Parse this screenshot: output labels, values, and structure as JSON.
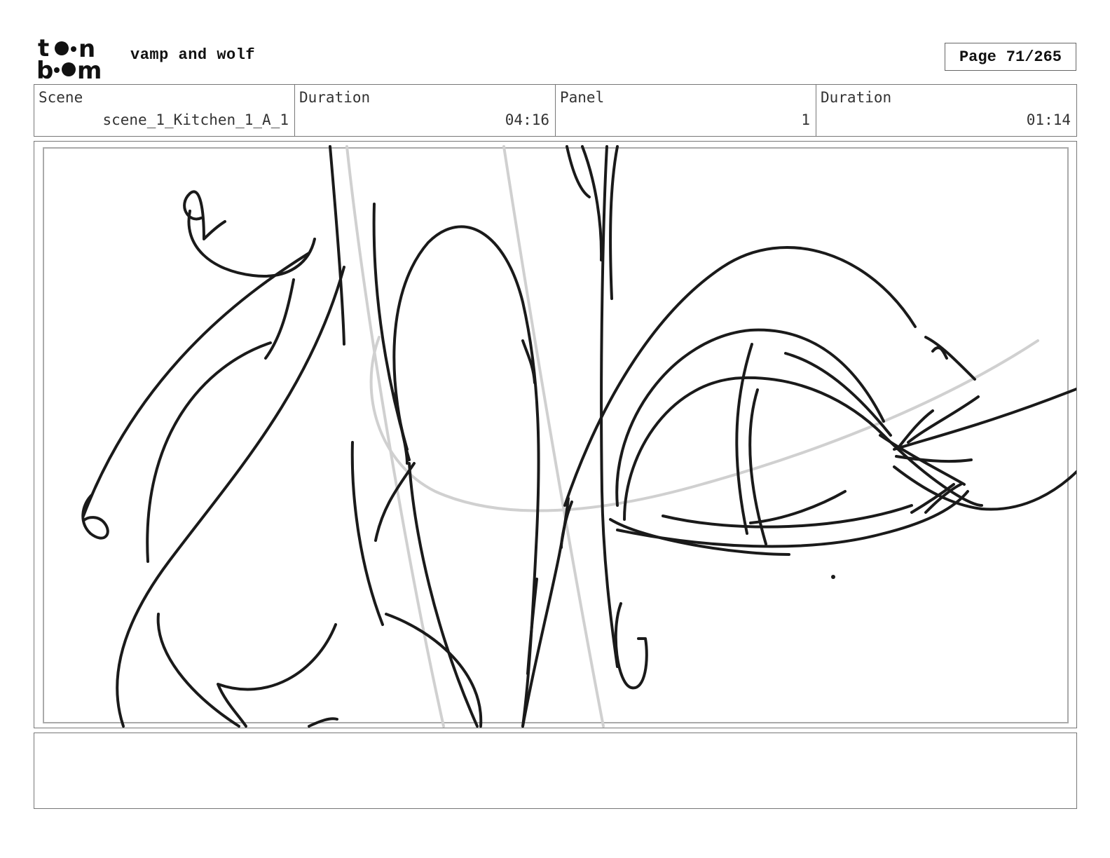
{
  "header": {
    "logo_lines": [
      "toon",
      "boom"
    ],
    "project_title": "vamp and wolf",
    "page_label": "Page",
    "page_number": "71/265"
  },
  "info": {
    "scene_label": "Scene",
    "scene_value": "scene_1_Kitchen_1_A_1",
    "scene_duration_label": "Duration",
    "scene_duration_value": "04:16",
    "panel_label": "Panel",
    "panel_value": "1",
    "panel_duration_label": "Duration",
    "panel_duration_value": "01:14"
  },
  "notes": {
    "text": ""
  }
}
